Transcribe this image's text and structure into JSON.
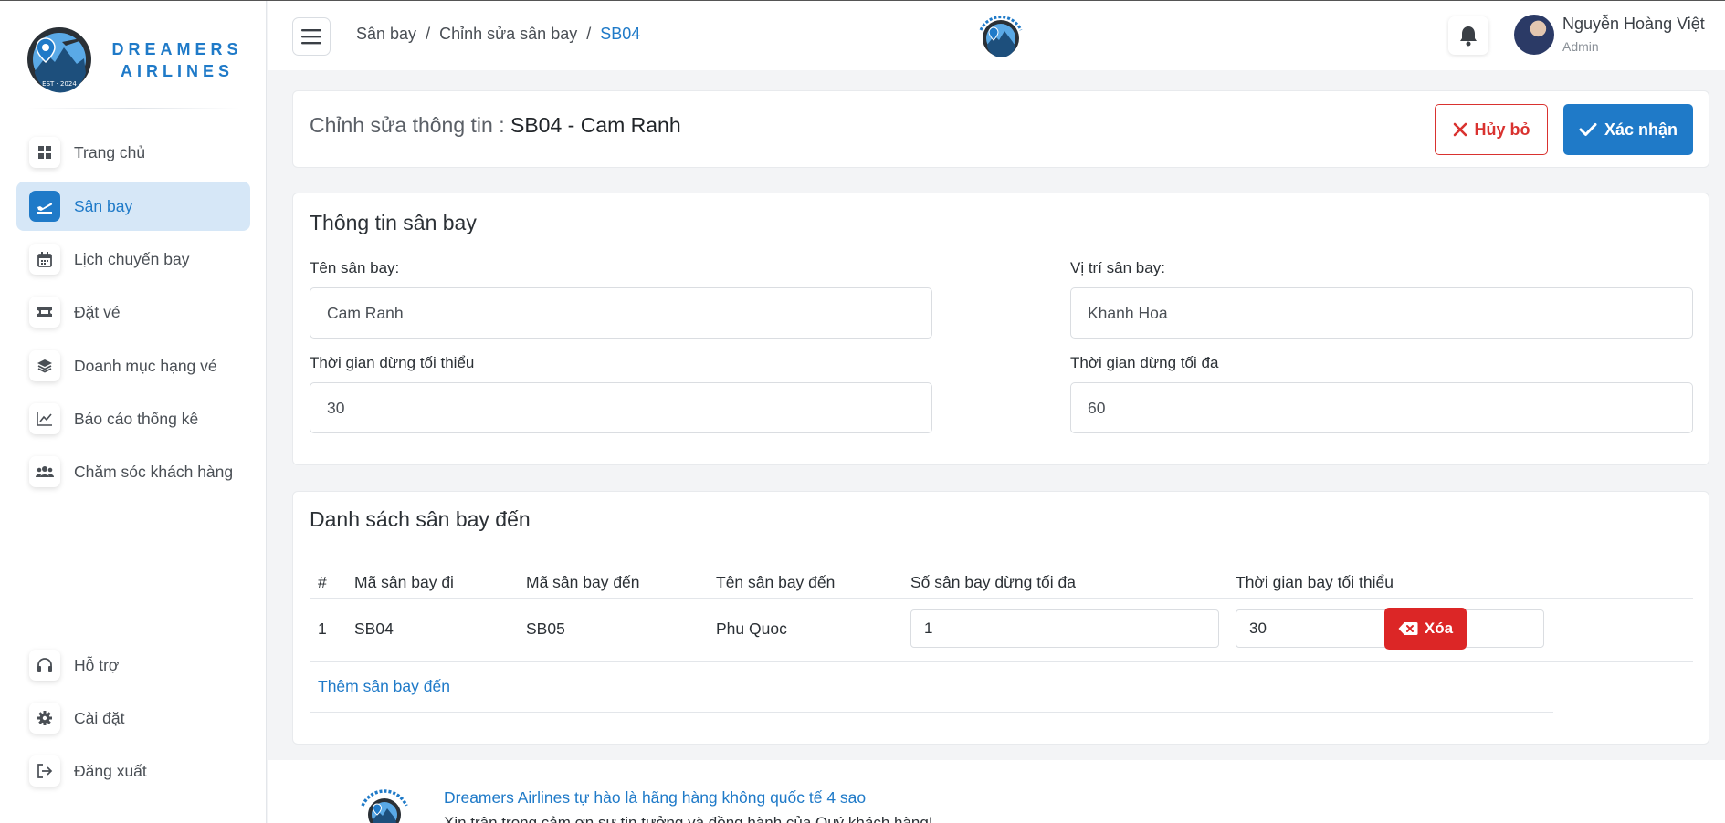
{
  "brand": {
    "line1": "DREAMERS",
    "line2": "AIRLINES"
  },
  "sidebar": {
    "items": [
      {
        "label": "Trang chủ",
        "icon": "windows-icon"
      },
      {
        "label": "Sân bay",
        "icon": "plane-departure-icon",
        "active": true
      },
      {
        "label": "Lịch chuyến bay",
        "icon": "calendar-icon"
      },
      {
        "label": "Đặt vé",
        "icon": "ticket-icon"
      },
      {
        "label": "Doanh mục hạng vé",
        "icon": "layers-icon"
      },
      {
        "label": "Báo cáo thống kê",
        "icon": "line-chart-icon"
      },
      {
        "label": "Chăm sóc khách hàng",
        "icon": "users-icon"
      }
    ],
    "bottom_items": [
      {
        "label": "Hỗ trợ",
        "icon": "headset-icon"
      },
      {
        "label": "Cài đặt",
        "icon": "gear-icon"
      },
      {
        "label": "Đăng xuất",
        "icon": "logout-icon"
      }
    ]
  },
  "header": {
    "breadcrumb": [
      "Sân bay",
      "Chỉnh sửa sân bay",
      "SB04"
    ],
    "separator": "/",
    "user_name": "Nguyễn Hoàng Việt",
    "user_role": "Admin"
  },
  "edit_bar": {
    "title_prefix": "Chỉnh sửa thông tin :",
    "title_value": "SB04 - Cam Ranh",
    "cancel_label": "Hủy bỏ",
    "confirm_label": "Xác nhận"
  },
  "airport_info": {
    "section_title": "Thông tin sân bay",
    "name_label": "Tên sân bay:",
    "name_value": "Cam Ranh",
    "location_label": "Vị trí sân bay:",
    "location_value": "Khanh Hoa",
    "min_stop_label": "Thời gian dừng tối thiểu",
    "min_stop_value": "30",
    "max_stop_label": "Thời gian dừng tối đa",
    "max_stop_value": "60"
  },
  "destinations": {
    "section_title": "Danh sách sân bay đến",
    "columns": [
      "#",
      "Mã sân bay đi",
      "Mã sân bay đến",
      "Tên sân bay đến",
      "Số sân bay dừng tối đa",
      "Thời gian bay tối thiểu"
    ],
    "rows": [
      {
        "index": "1",
        "from": "SB04",
        "to": "SB05",
        "to_name": "Phu Quoc",
        "max_stops": "1",
        "min_flight_time": "30",
        "delete_label": "Xóa"
      }
    ],
    "add_label": "Thêm sân bay đến"
  },
  "footer": {
    "tagline": "Dreamers Airlines tự hào là hãng hàng không quốc tế 4 sao",
    "subline": "Xin trân trọng cảm ơn sự tin tưởng và đồng hành của Quý khách hàng!"
  },
  "colors": {
    "primary": "#1f7ac8",
    "danger": "#dc2626",
    "active_bg": "#d6e7f7"
  }
}
